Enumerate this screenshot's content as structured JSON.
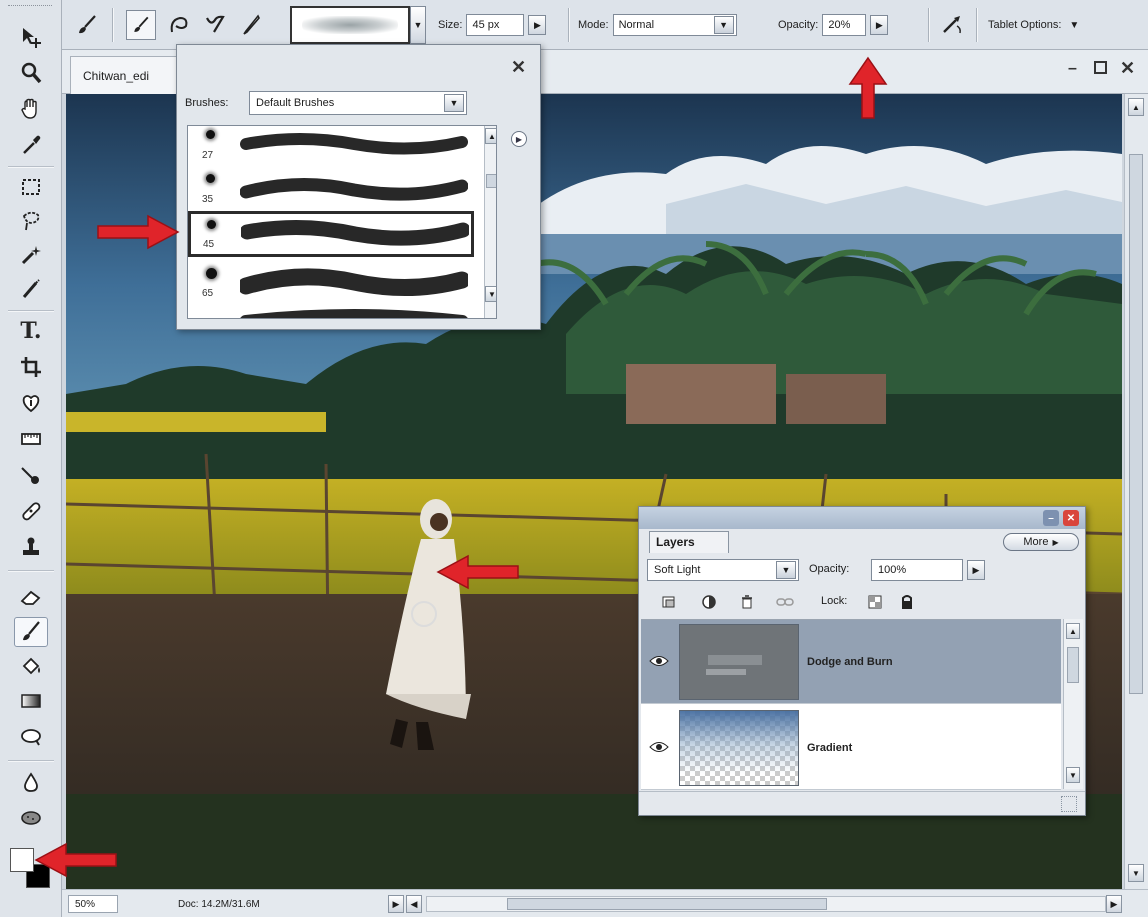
{
  "options_bar": {
    "size_label": "Size:",
    "size_value": "45 px",
    "mode_label": "Mode:",
    "mode_value": "Normal",
    "opacity_label": "Opacity:",
    "opacity_value": "20%",
    "tablet_options_label": "Tablet Options:"
  },
  "document": {
    "tab_title": "Chitwan_edi",
    "zoom": "50%",
    "doc_size": "Doc: 14.2M/31.6M"
  },
  "brush_picker": {
    "brushes_label": "Brushes:",
    "brushes_set": "Default Brushes",
    "brush_sizes": [
      "27",
      "35",
      "45",
      "65"
    ],
    "selected_size": "45"
  },
  "layers_palette": {
    "tab_label": "Layers",
    "more_label": "More",
    "blend_mode": "Soft Light",
    "opacity_label": "Opacity:",
    "opacity_value": "100%",
    "lock_label": "Lock:",
    "layers": [
      {
        "name": "Dodge and Burn",
        "selected": true
      },
      {
        "name": "Gradient",
        "selected": false
      }
    ]
  },
  "icons": {
    "toolbox": [
      "move-icon",
      "zoom-icon",
      "hand-icon",
      "eyedropper-icon",
      "marquee-icon",
      "lasso-icon",
      "magic-wand-icon",
      "selection-brush-icon",
      "type-icon",
      "crop-icon",
      "cookie-cutter-icon",
      "straighten-icon",
      "red-eye-icon",
      "healing-brush-icon",
      "clone-stamp-icon",
      "eraser-icon",
      "brush-icon",
      "paint-bucket-icon",
      "gradient-icon",
      "shape-icon",
      "blur-icon",
      "sponge-icon"
    ]
  },
  "colors": {
    "foreground": "#ffffff",
    "background": "#000000",
    "annotation_arrow": "#e0242a"
  }
}
